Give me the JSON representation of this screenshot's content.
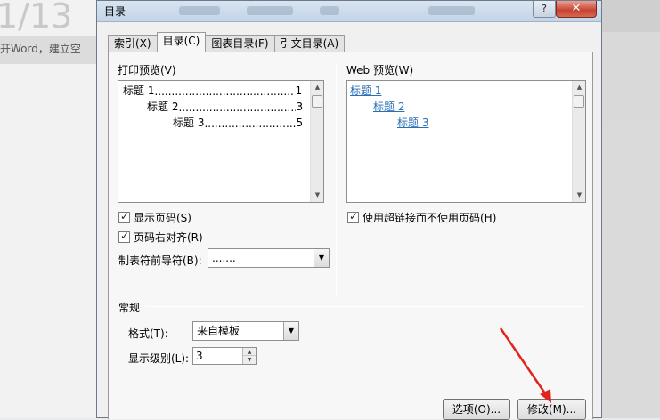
{
  "background": {
    "page_number": "1/13",
    "doc_text": "开Word，建立空"
  },
  "dialog": {
    "title": "目录",
    "help_label": "?",
    "close_label": "✕",
    "tabs": [
      {
        "label": "索引(X)",
        "active": false
      },
      {
        "label": "目录(C)",
        "active": true
      },
      {
        "label": "图表目录(F)",
        "active": false
      },
      {
        "label": "引文目录(A)",
        "active": false
      }
    ],
    "print_preview": {
      "label": "打印预览(V)",
      "entries": [
        {
          "text": "标题 1",
          "page": "1"
        },
        {
          "text": "标题 2",
          "page": "3"
        },
        {
          "text": "标题 3",
          "page": "5"
        }
      ]
    },
    "web_preview": {
      "label": "Web 预览(W)",
      "entries": [
        "标题 1",
        "标题 2",
        "标题 3"
      ]
    },
    "show_page_numbers": {
      "label": "显示页码(S)",
      "checked": true
    },
    "right_align_page_numbers": {
      "label": "页码右对齐(R)",
      "checked": true
    },
    "tab_leader": {
      "label": "制表符前导符(B):",
      "value": "......."
    },
    "use_hyperlinks": {
      "label": "使用超链接而不使用页码(H)",
      "checked": true
    },
    "general": {
      "section_label": "常规",
      "format_label": "格式(T):",
      "format_value": "来自模板",
      "levels_label": "显示级别(L):",
      "levels_value": "3"
    },
    "buttons": {
      "options": "选项(O)...",
      "modify": "修改(M)..."
    }
  },
  "colors": {
    "link": "#2a6fb5",
    "annotation_arrow": "#e0231d",
    "close_button": "#c6422f"
  }
}
